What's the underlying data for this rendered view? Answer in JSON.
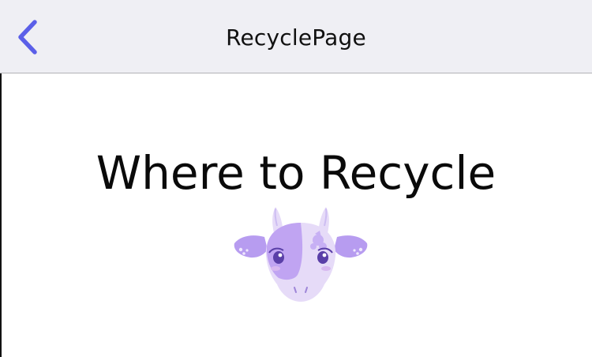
{
  "navbar": {
    "title": "RecyclePage",
    "back_icon": "chevron-left-icon",
    "accent_color": "#5b5fe8"
  },
  "main": {
    "heading": "Where to Recycle",
    "mascot_icon": "cow-mascot-icon"
  }
}
